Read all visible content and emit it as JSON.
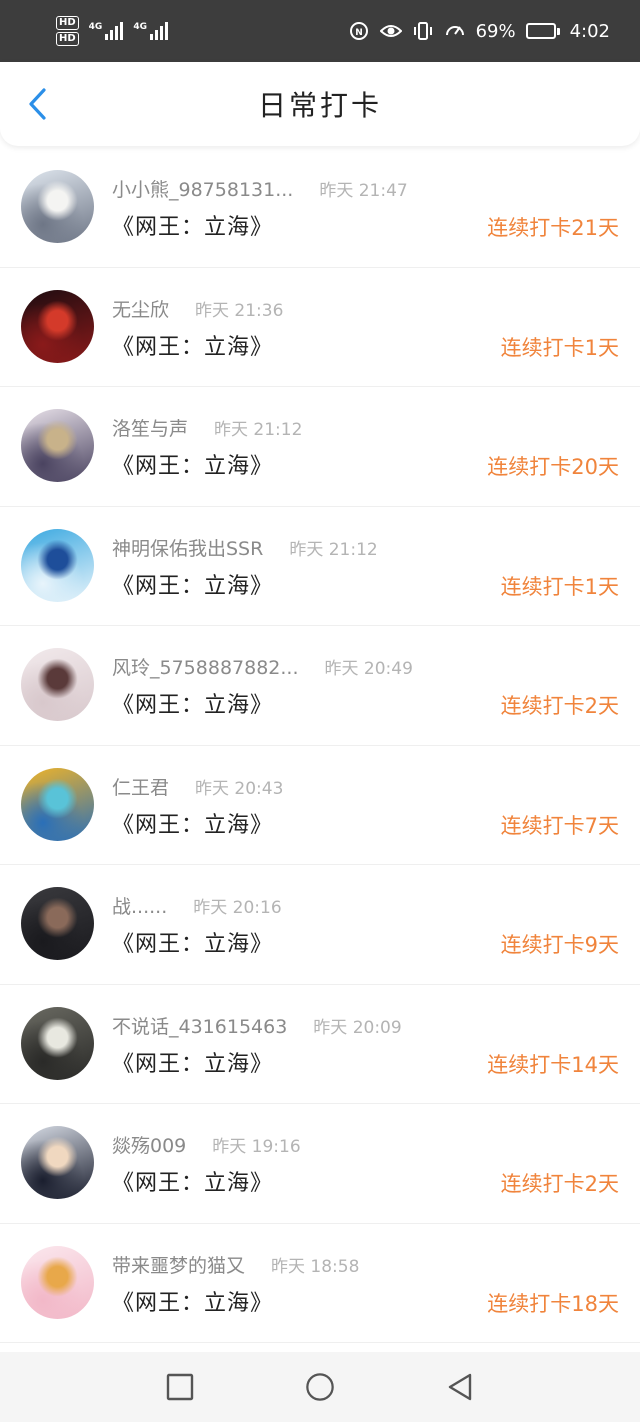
{
  "status_bar": {
    "sim1": "HD",
    "sim2": "HD",
    "net1": "4G",
    "net2": "4G",
    "battery_text": "69%",
    "battery_level": 0.69,
    "time": "4:02"
  },
  "header": {
    "title": "日常打卡",
    "back_icon": "chevron-left-icon",
    "accent": "#2b8fe8"
  },
  "colors": {
    "streak": "#f0843c",
    "name": "#8a8a8a",
    "time": "#b4b4b4"
  },
  "checkins": [
    {
      "user": "小小熊_98758131...",
      "time": "昨天 21:47",
      "book": "《网王：立海》",
      "streak": "连续打卡21天",
      "avatar_colors": [
        "#dfe6ee",
        "#6e7686",
        "#f4f4f2"
      ]
    },
    {
      "user": "无尘欣",
      "time": "昨天 21:36",
      "book": "《网王：立海》",
      "streak": "连续打卡1天",
      "avatar_colors": [
        "#1d0c10",
        "#8a1a1a",
        "#d43a2a"
      ]
    },
    {
      "user": "洛笙与声",
      "time": "昨天 21:12",
      "book": "《网王：立海》",
      "streak": "连续打卡20天",
      "avatar_colors": [
        "#e9e2ea",
        "#4a4360",
        "#c8b28a"
      ]
    },
    {
      "user": "神明保佑我出SSR",
      "time": "昨天 21:12",
      "book": "《网王：立海》",
      "streak": "连续打卡1天",
      "avatar_colors": [
        "#3aa8e0",
        "#e8f4fb",
        "#1e4e9a"
      ]
    },
    {
      "user": "风玲_5758887882...",
      "time": "昨天 20:49",
      "book": "《网王：立海》",
      "streak": "连续打卡2天",
      "avatar_colors": [
        "#f2eaec",
        "#d8c8cc",
        "#5a3a3a"
      ]
    },
    {
      "user": "仁王君",
      "time": "昨天 20:43",
      "book": "《网王：立海》",
      "streak": "连续打卡7天",
      "avatar_colors": [
        "#f0b428",
        "#2a6fb8",
        "#59c3d8"
      ]
    },
    {
      "user": "战......",
      "time": "昨天 20:16",
      "book": "《网王：立海》",
      "streak": "连续打卡9天",
      "avatar_colors": [
        "#3a3a3e",
        "#1a1a1e",
        "#8a6a5a"
      ]
    },
    {
      "user": "不说话_431615463",
      "time": "昨天 20:09",
      "book": "《网王：立海》",
      "streak": "连续打卡14天",
      "avatar_colors": [
        "#6a6a62",
        "#2a2a28",
        "#e8e8e0"
      ]
    },
    {
      "user": "燚殇009",
      "time": "昨天 19:16",
      "book": "《网王：立海》",
      "streak": "连续打卡2天",
      "avatar_colors": [
        "#d8dde6",
        "#1a1e2e",
        "#f0d8c0"
      ]
    },
    {
      "user": "带来噩梦的猫又",
      "time": "昨天 18:58",
      "book": "《网王：立海》",
      "streak": "连续打卡18天",
      "avatar_colors": [
        "#fbe8ee",
        "#f2b8c8",
        "#e8a84a"
      ]
    }
  ],
  "nav": {
    "recents_icon": "square-icon",
    "home_icon": "circle-icon",
    "back_icon": "triangle-back-icon"
  }
}
